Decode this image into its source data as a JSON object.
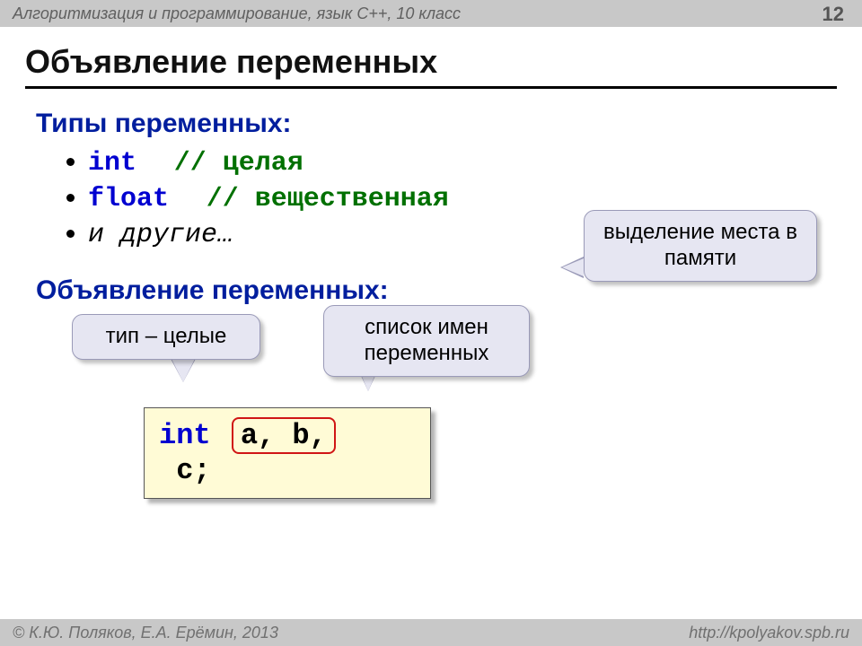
{
  "header": {
    "course": "Алгоритмизация и программирование, язык  C++, 10 класс",
    "page": "12"
  },
  "title": "Объявление  переменных",
  "section_types": "Типы переменных:",
  "types": {
    "int_kw": "int",
    "int_cm": "// целая",
    "float_kw": "float",
    "float_cm": "// вещественная",
    "other": "и другие…"
  },
  "section_decl": "Объявление переменных:",
  "callouts": {
    "memory": "выделение места в памяти",
    "type_int": "тип – целые",
    "names": "список имен переменных"
  },
  "code": {
    "kw": "int",
    "vars": "a, b,",
    "rest": "c;"
  },
  "footer": {
    "authors": "© К.Ю. Поляков, Е.А. Ерёмин, 2013",
    "url": "http://kpolyakov.spb.ru"
  }
}
